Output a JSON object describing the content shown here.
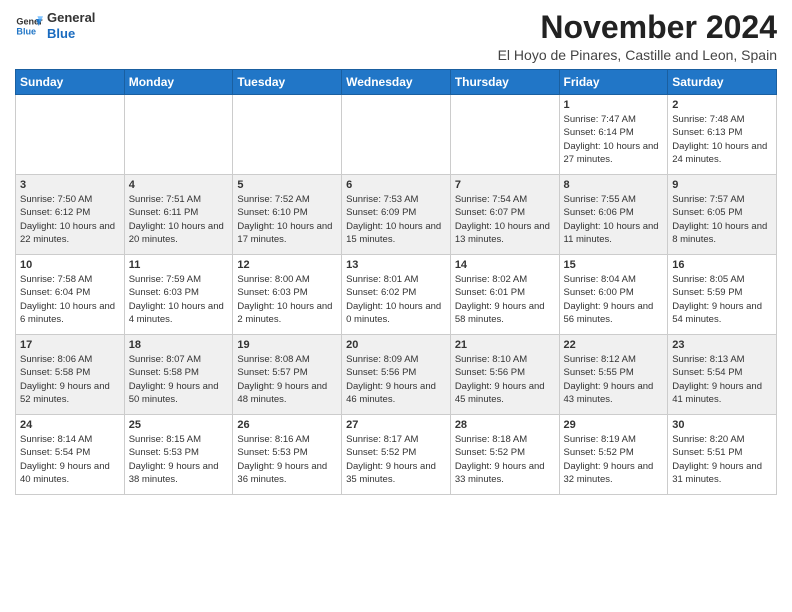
{
  "header": {
    "logo_line1": "General",
    "logo_line2": "Blue",
    "month_title": "November 2024",
    "location": "El Hoyo de Pinares, Castille and Leon, Spain"
  },
  "weekdays": [
    "Sunday",
    "Monday",
    "Tuesday",
    "Wednesday",
    "Thursday",
    "Friday",
    "Saturday"
  ],
  "weeks": [
    [
      {
        "day": "",
        "info": ""
      },
      {
        "day": "",
        "info": ""
      },
      {
        "day": "",
        "info": ""
      },
      {
        "day": "",
        "info": ""
      },
      {
        "day": "",
        "info": ""
      },
      {
        "day": "1",
        "info": "Sunrise: 7:47 AM\nSunset: 6:14 PM\nDaylight: 10 hours and 27 minutes."
      },
      {
        "day": "2",
        "info": "Sunrise: 7:48 AM\nSunset: 6:13 PM\nDaylight: 10 hours and 24 minutes."
      }
    ],
    [
      {
        "day": "3",
        "info": "Sunrise: 7:50 AM\nSunset: 6:12 PM\nDaylight: 10 hours and 22 minutes."
      },
      {
        "day": "4",
        "info": "Sunrise: 7:51 AM\nSunset: 6:11 PM\nDaylight: 10 hours and 20 minutes."
      },
      {
        "day": "5",
        "info": "Sunrise: 7:52 AM\nSunset: 6:10 PM\nDaylight: 10 hours and 17 minutes."
      },
      {
        "day": "6",
        "info": "Sunrise: 7:53 AM\nSunset: 6:09 PM\nDaylight: 10 hours and 15 minutes."
      },
      {
        "day": "7",
        "info": "Sunrise: 7:54 AM\nSunset: 6:07 PM\nDaylight: 10 hours and 13 minutes."
      },
      {
        "day": "8",
        "info": "Sunrise: 7:55 AM\nSunset: 6:06 PM\nDaylight: 10 hours and 11 minutes."
      },
      {
        "day": "9",
        "info": "Sunrise: 7:57 AM\nSunset: 6:05 PM\nDaylight: 10 hours and 8 minutes."
      }
    ],
    [
      {
        "day": "10",
        "info": "Sunrise: 7:58 AM\nSunset: 6:04 PM\nDaylight: 10 hours and 6 minutes."
      },
      {
        "day": "11",
        "info": "Sunrise: 7:59 AM\nSunset: 6:03 PM\nDaylight: 10 hours and 4 minutes."
      },
      {
        "day": "12",
        "info": "Sunrise: 8:00 AM\nSunset: 6:03 PM\nDaylight: 10 hours and 2 minutes."
      },
      {
        "day": "13",
        "info": "Sunrise: 8:01 AM\nSunset: 6:02 PM\nDaylight: 10 hours and 0 minutes."
      },
      {
        "day": "14",
        "info": "Sunrise: 8:02 AM\nSunset: 6:01 PM\nDaylight: 9 hours and 58 minutes."
      },
      {
        "day": "15",
        "info": "Sunrise: 8:04 AM\nSunset: 6:00 PM\nDaylight: 9 hours and 56 minutes."
      },
      {
        "day": "16",
        "info": "Sunrise: 8:05 AM\nSunset: 5:59 PM\nDaylight: 9 hours and 54 minutes."
      }
    ],
    [
      {
        "day": "17",
        "info": "Sunrise: 8:06 AM\nSunset: 5:58 PM\nDaylight: 9 hours and 52 minutes."
      },
      {
        "day": "18",
        "info": "Sunrise: 8:07 AM\nSunset: 5:58 PM\nDaylight: 9 hours and 50 minutes."
      },
      {
        "day": "19",
        "info": "Sunrise: 8:08 AM\nSunset: 5:57 PM\nDaylight: 9 hours and 48 minutes."
      },
      {
        "day": "20",
        "info": "Sunrise: 8:09 AM\nSunset: 5:56 PM\nDaylight: 9 hours and 46 minutes."
      },
      {
        "day": "21",
        "info": "Sunrise: 8:10 AM\nSunset: 5:56 PM\nDaylight: 9 hours and 45 minutes."
      },
      {
        "day": "22",
        "info": "Sunrise: 8:12 AM\nSunset: 5:55 PM\nDaylight: 9 hours and 43 minutes."
      },
      {
        "day": "23",
        "info": "Sunrise: 8:13 AM\nSunset: 5:54 PM\nDaylight: 9 hours and 41 minutes."
      }
    ],
    [
      {
        "day": "24",
        "info": "Sunrise: 8:14 AM\nSunset: 5:54 PM\nDaylight: 9 hours and 40 minutes."
      },
      {
        "day": "25",
        "info": "Sunrise: 8:15 AM\nSunset: 5:53 PM\nDaylight: 9 hours and 38 minutes."
      },
      {
        "day": "26",
        "info": "Sunrise: 8:16 AM\nSunset: 5:53 PM\nDaylight: 9 hours and 36 minutes."
      },
      {
        "day": "27",
        "info": "Sunrise: 8:17 AM\nSunset: 5:52 PM\nDaylight: 9 hours and 35 minutes."
      },
      {
        "day": "28",
        "info": "Sunrise: 8:18 AM\nSunset: 5:52 PM\nDaylight: 9 hours and 33 minutes."
      },
      {
        "day": "29",
        "info": "Sunrise: 8:19 AM\nSunset: 5:52 PM\nDaylight: 9 hours and 32 minutes."
      },
      {
        "day": "30",
        "info": "Sunrise: 8:20 AM\nSunset: 5:51 PM\nDaylight: 9 hours and 31 minutes."
      }
    ]
  ]
}
